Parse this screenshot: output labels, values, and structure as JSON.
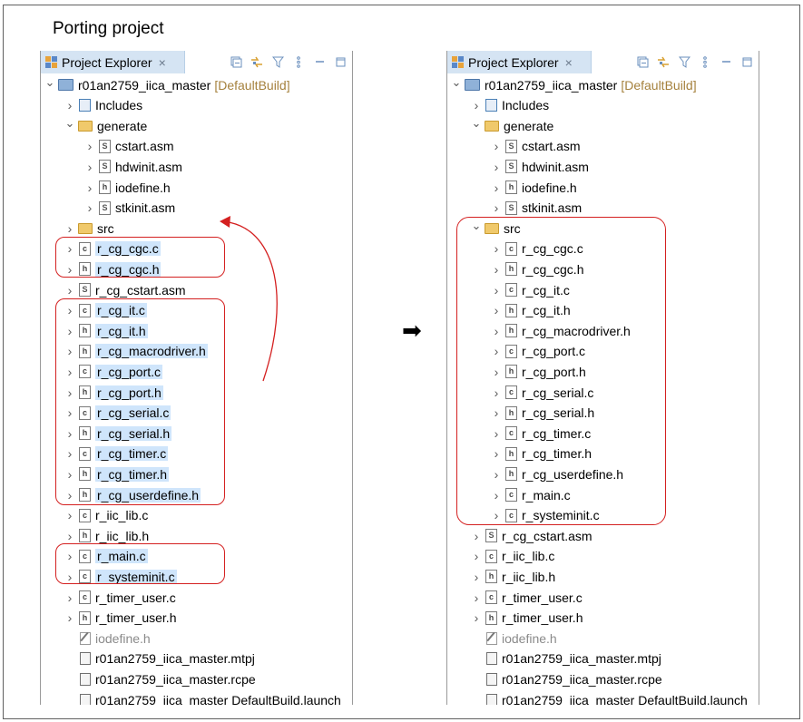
{
  "caption": "Porting project",
  "tab_label": "Project Explorer",
  "tab_close": "×",
  "arrow_glyph": "➡",
  "icons": {
    "collapse_all": "collapse-all-icon",
    "link_editor": "link-with-editor-icon",
    "filter": "filter-icon",
    "view_menu": "view-menu-icon",
    "minimize": "minimize-icon",
    "maximize": "maximize-icon"
  },
  "colors": {
    "selection": "#cfe5fb",
    "tab_bg": "#d5e4f3",
    "highlight": "#d42020",
    "build_config": "#a5813d"
  },
  "left_tree": [
    {
      "label": "r01an2759_iica_master",
      "suffix": "[DefaultBuild]",
      "kind": "project",
      "depth": 0,
      "chev": "open"
    },
    {
      "label": "Includes",
      "kind": "inc",
      "depth": 1,
      "chev": "closed"
    },
    {
      "label": "generate",
      "kind": "folder",
      "depth": 1,
      "chev": "open"
    },
    {
      "label": "cstart.asm",
      "kind": "asm",
      "depth": 2,
      "chev": "closed"
    },
    {
      "label": "hdwinit.asm",
      "kind": "asm",
      "depth": 2,
      "chev": "closed"
    },
    {
      "label": "iodefine.h",
      "kind": "h",
      "depth": 2,
      "chev": "closed"
    },
    {
      "label": "stkinit.asm",
      "kind": "asm",
      "depth": 2,
      "chev": "closed"
    },
    {
      "label": "src",
      "kind": "folder",
      "depth": 1,
      "chev": "closed"
    },
    {
      "label": "r_cg_cgc.c",
      "kind": "c",
      "depth": 1,
      "chev": "closed",
      "sel": true
    },
    {
      "label": "r_cg_cgc.h",
      "kind": "h",
      "depth": 1,
      "chev": "closed",
      "sel": true
    },
    {
      "label": "r_cg_cstart.asm",
      "kind": "asm",
      "depth": 1,
      "chev": "closed"
    },
    {
      "label": "r_cg_it.c",
      "kind": "c",
      "depth": 1,
      "chev": "closed",
      "sel": true
    },
    {
      "label": "r_cg_it.h",
      "kind": "h",
      "depth": 1,
      "chev": "closed",
      "sel": true
    },
    {
      "label": "r_cg_macrodriver.h",
      "kind": "h",
      "depth": 1,
      "chev": "closed",
      "sel": true
    },
    {
      "label": "r_cg_port.c",
      "kind": "c",
      "depth": 1,
      "chev": "closed",
      "sel": true
    },
    {
      "label": "r_cg_port.h",
      "kind": "h",
      "depth": 1,
      "chev": "closed",
      "sel": true
    },
    {
      "label": "r_cg_serial.c",
      "kind": "c",
      "depth": 1,
      "chev": "closed",
      "sel": true
    },
    {
      "label": "r_cg_serial.h",
      "kind": "h",
      "depth": 1,
      "chev": "closed",
      "sel": true
    },
    {
      "label": "r_cg_timer.c",
      "kind": "c",
      "depth": 1,
      "chev": "closed",
      "sel": true
    },
    {
      "label": "r_cg_timer.h",
      "kind": "h",
      "depth": 1,
      "chev": "closed",
      "sel": true
    },
    {
      "label": "r_cg_userdefine.h",
      "kind": "h",
      "depth": 1,
      "chev": "closed",
      "sel": true
    },
    {
      "label": "r_iic_lib.c",
      "kind": "c",
      "depth": 1,
      "chev": "closed"
    },
    {
      "label": "r_iic_lib.h",
      "kind": "h",
      "depth": 1,
      "chev": "closed"
    },
    {
      "label": "r_main.c",
      "kind": "c",
      "depth": 1,
      "chev": "closed",
      "sel": true
    },
    {
      "label": "r_systeminit.c",
      "kind": "c",
      "depth": 1,
      "chev": "closed",
      "sel": true
    },
    {
      "label": "r_timer_user.c",
      "kind": "c",
      "depth": 1,
      "chev": "closed"
    },
    {
      "label": "r_timer_user.h",
      "kind": "h",
      "depth": 1,
      "chev": "closed"
    },
    {
      "label": "iodefine.h",
      "kind": "edit",
      "depth": 1,
      "chev": "none",
      "gray": true
    },
    {
      "label": "r01an2759_iica_master.mtpj",
      "kind": "file",
      "depth": 1,
      "chev": "none"
    },
    {
      "label": "r01an2759_iica_master.rcpe",
      "kind": "file",
      "depth": 1,
      "chev": "none"
    },
    {
      "label": "r01an2759_iica_master DefaultBuild.launch",
      "kind": "file",
      "depth": 1,
      "chev": "none"
    }
  ],
  "right_tree": [
    {
      "label": "r01an2759_iica_master",
      "suffix": "[DefaultBuild]",
      "kind": "project",
      "depth": 0,
      "chev": "open"
    },
    {
      "label": "Includes",
      "kind": "inc",
      "depth": 1,
      "chev": "closed"
    },
    {
      "label": "generate",
      "kind": "folder",
      "depth": 1,
      "chev": "open"
    },
    {
      "label": "cstart.asm",
      "kind": "asm",
      "depth": 2,
      "chev": "closed"
    },
    {
      "label": "hdwinit.asm",
      "kind": "asm",
      "depth": 2,
      "chev": "closed"
    },
    {
      "label": "iodefine.h",
      "kind": "h",
      "depth": 2,
      "chev": "closed"
    },
    {
      "label": "stkinit.asm",
      "kind": "asm",
      "depth": 2,
      "chev": "closed"
    },
    {
      "label": "src",
      "kind": "folder",
      "depth": 1,
      "chev": "open"
    },
    {
      "label": "r_cg_cgc.c",
      "kind": "c",
      "depth": 2,
      "chev": "closed"
    },
    {
      "label": "r_cg_cgc.h",
      "kind": "h",
      "depth": 2,
      "chev": "closed"
    },
    {
      "label": "r_cg_it.c",
      "kind": "c",
      "depth": 2,
      "chev": "closed"
    },
    {
      "label": "r_cg_it.h",
      "kind": "h",
      "depth": 2,
      "chev": "closed"
    },
    {
      "label": "r_cg_macrodriver.h",
      "kind": "h",
      "depth": 2,
      "chev": "closed"
    },
    {
      "label": "r_cg_port.c",
      "kind": "c",
      "depth": 2,
      "chev": "closed"
    },
    {
      "label": "r_cg_port.h",
      "kind": "h",
      "depth": 2,
      "chev": "closed"
    },
    {
      "label": "r_cg_serial.c",
      "kind": "c",
      "depth": 2,
      "chev": "closed"
    },
    {
      "label": "r_cg_serial.h",
      "kind": "h",
      "depth": 2,
      "chev": "closed"
    },
    {
      "label": "r_cg_timer.c",
      "kind": "c",
      "depth": 2,
      "chev": "closed"
    },
    {
      "label": "r_cg_timer.h",
      "kind": "h",
      "depth": 2,
      "chev": "closed"
    },
    {
      "label": "r_cg_userdefine.h",
      "kind": "h",
      "depth": 2,
      "chev": "closed"
    },
    {
      "label": "r_main.c",
      "kind": "c",
      "depth": 2,
      "chev": "closed"
    },
    {
      "label": "r_systeminit.c",
      "kind": "c",
      "depth": 2,
      "chev": "closed"
    },
    {
      "label": "r_cg_cstart.asm",
      "kind": "asm",
      "depth": 1,
      "chev": "closed"
    },
    {
      "label": "r_iic_lib.c",
      "kind": "c",
      "depth": 1,
      "chev": "closed"
    },
    {
      "label": "r_iic_lib.h",
      "kind": "h",
      "depth": 1,
      "chev": "closed"
    },
    {
      "label": "r_timer_user.c",
      "kind": "c",
      "depth": 1,
      "chev": "closed"
    },
    {
      "label": "r_timer_user.h",
      "kind": "h",
      "depth": 1,
      "chev": "closed"
    },
    {
      "label": "iodefine.h",
      "kind": "edit",
      "depth": 1,
      "chev": "none",
      "gray": true
    },
    {
      "label": "r01an2759_iica_master.mtpj",
      "kind": "file",
      "depth": 1,
      "chev": "none"
    },
    {
      "label": "r01an2759_iica_master.rcpe",
      "kind": "file",
      "depth": 1,
      "chev": "none"
    },
    {
      "label": "r01an2759_iica_master DefaultBuild.launch",
      "kind": "file",
      "depth": 1,
      "chev": "none"
    }
  ]
}
